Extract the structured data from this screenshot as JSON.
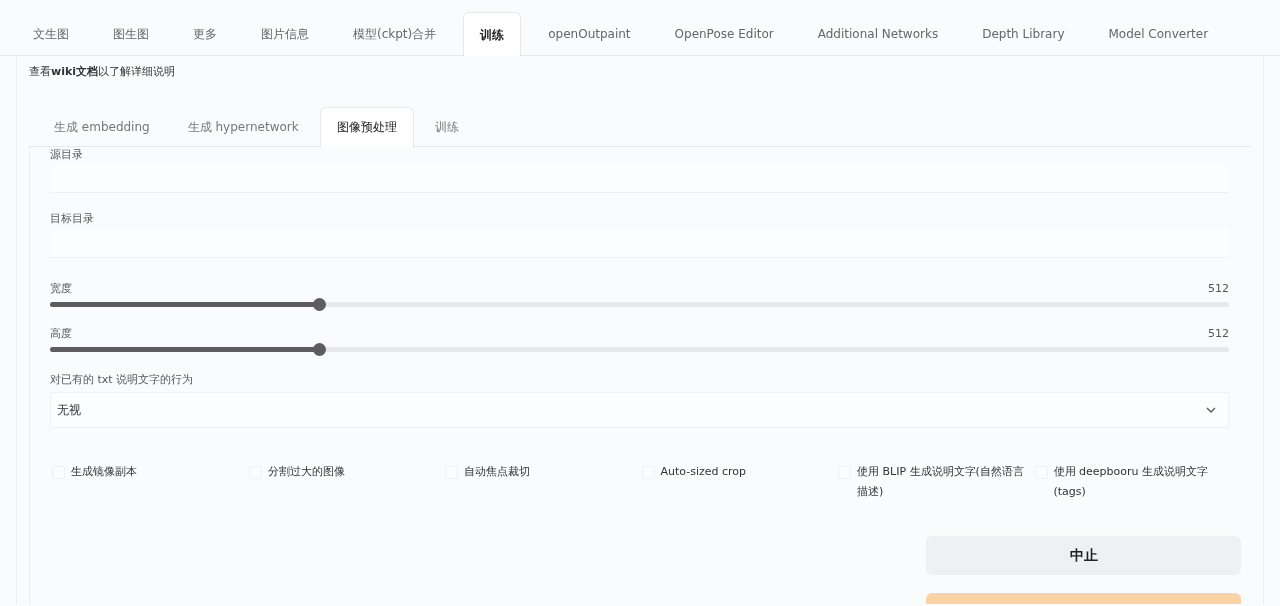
{
  "main_tabs": [
    {
      "label": "文生图",
      "selected": false
    },
    {
      "label": "图生图",
      "selected": false
    },
    {
      "label": "更多",
      "selected": false
    },
    {
      "label": "图片信息",
      "selected": false
    },
    {
      "label": "模型(ckpt)合并",
      "selected": false
    },
    {
      "label": "训练",
      "selected": true
    },
    {
      "label": "openOutpaint",
      "selected": false
    },
    {
      "label": "OpenPose Editor",
      "selected": false
    },
    {
      "label": "Additional Networks",
      "selected": false
    },
    {
      "label": "Depth Library",
      "selected": false
    },
    {
      "label": "Model Converter",
      "selected": false
    }
  ],
  "wiki_note": "查看**wiki文档**以了解详细说明",
  "sub_tabs": [
    {
      "label": "生成 embedding",
      "selected": false
    },
    {
      "label": "生成 hypernetwork",
      "selected": false
    },
    {
      "label": "图像预处理",
      "selected": true
    },
    {
      "label": "训练",
      "selected": false
    }
  ],
  "text_fields": [
    {
      "label": "源目录"
    },
    {
      "label": "目标目录"
    }
  ],
  "sliders": [
    {
      "label": "宽度",
      "reading": "512",
      "level": 0.228
    },
    {
      "label": "高度",
      "reading": "512",
      "level": 0.228
    }
  ],
  "dropdown": {
    "label": "对已有的 txt 说明文字的行为",
    "value": "无视"
  },
  "checkboxes": [
    {
      "label": "生成镜像副本",
      "checked": false
    },
    {
      "label": "分割过大的图像",
      "checked": false
    },
    {
      "label": "自动焦点裁切",
      "checked": false
    },
    {
      "label": "Auto-sized crop",
      "checked": false
    },
    {
      "label": "使用 BLIP 生成说明文字(自然语言描述)",
      "checked": false
    },
    {
      "label": "使用 deepbooru 生成说明文字(tags)",
      "checked": false
    }
  ],
  "buttons": [
    {
      "label": "中止",
      "kind": "secondary"
    },
    {
      "kind": "primary"
    }
  ]
}
